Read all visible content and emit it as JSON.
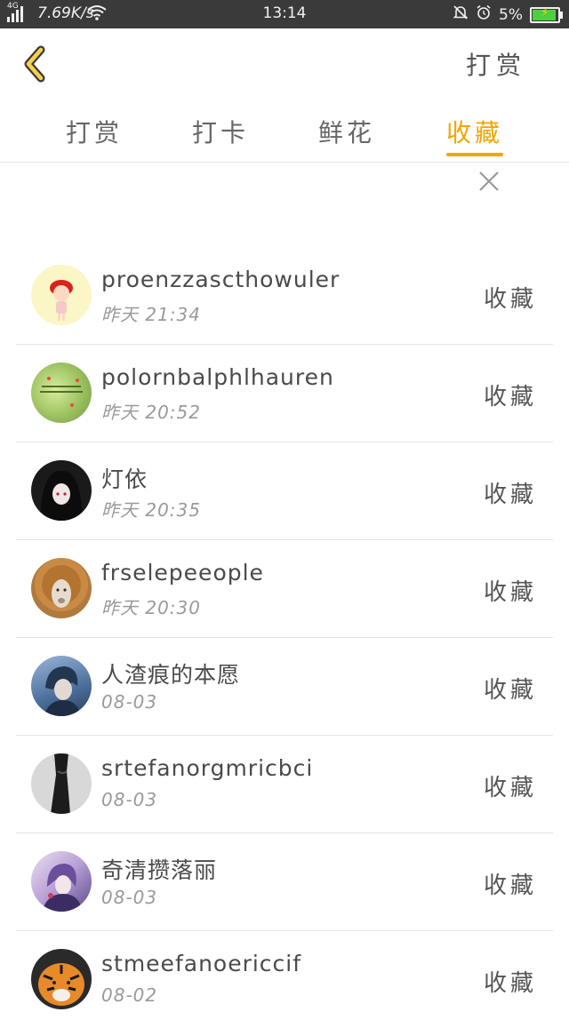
{
  "status_bar": {
    "network": "4G",
    "speed": "7.69K/s",
    "time": "13:14",
    "battery": "5%"
  },
  "header": {
    "back_icon": "chevron-left-icon",
    "action_label": "打赏"
  },
  "tabs": [
    {
      "label": "打赏"
    },
    {
      "label": "打卡"
    },
    {
      "label": "鲜花"
    },
    {
      "label": "收藏"
    }
  ],
  "active_tab": 3,
  "accent_color": "#f2a500",
  "list": [
    {
      "name": "proenzzascthowuler",
      "time": "昨天 21:34",
      "action": "收藏"
    },
    {
      "name": "polornbalphlhauren",
      "time": "昨天 20:52",
      "action": "收藏"
    },
    {
      "name": "灯依",
      "time": "昨天 20:35",
      "action": "收藏"
    },
    {
      "name": "frselepeeople",
      "time": "昨天 20:30",
      "action": "收藏"
    },
    {
      "name": "人渣痕的本愿",
      "time": "08-03",
      "action": "收藏"
    },
    {
      "name": "srtefanorgmricbci",
      "time": "08-03",
      "action": "收藏"
    },
    {
      "name": "奇清攒落丽",
      "time": "08-03",
      "action": "收藏"
    },
    {
      "name": "stmeefanoericcif",
      "time": "08-02",
      "action": "收藏"
    }
  ]
}
